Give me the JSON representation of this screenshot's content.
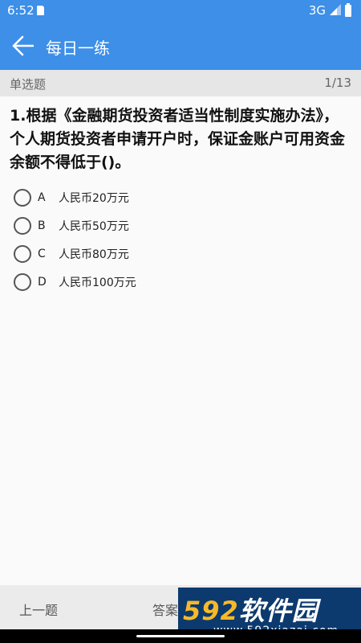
{
  "status_bar": {
    "time": "6:52",
    "network": "3G",
    "icons": [
      "sd-card-icon",
      "signal-icon",
      "battery-icon"
    ]
  },
  "app_bar": {
    "title": "每日一练",
    "back_icon": "arrow-left-icon"
  },
  "question_header": {
    "type": "单选题",
    "progress": "1/13"
  },
  "question": {
    "text": "1.根据《金融期货投资者适当性制度实施办法》，个人期货投资者申请开户时，保证金账户可用资金余额不得低于()。"
  },
  "options": [
    {
      "letter": "A",
      "text": "人民币20万元",
      "selected": false
    },
    {
      "letter": "B",
      "text": "人民币50万元",
      "selected": false
    },
    {
      "letter": "C",
      "text": "人民币80万元",
      "selected": false
    },
    {
      "letter": "D",
      "text": "人民币100万元",
      "selected": false
    }
  ],
  "bottom_bar": {
    "prev_label": "上一题",
    "answer_label": "答案"
  },
  "watermark": {
    "brand_num": "592",
    "brand_text": "软件园",
    "url": "www.592xiazai.com"
  },
  "colors": {
    "primary": "#3d8fe8",
    "watermark_bg": "#0d3a6e",
    "watermark_accent": "#f7b928"
  }
}
